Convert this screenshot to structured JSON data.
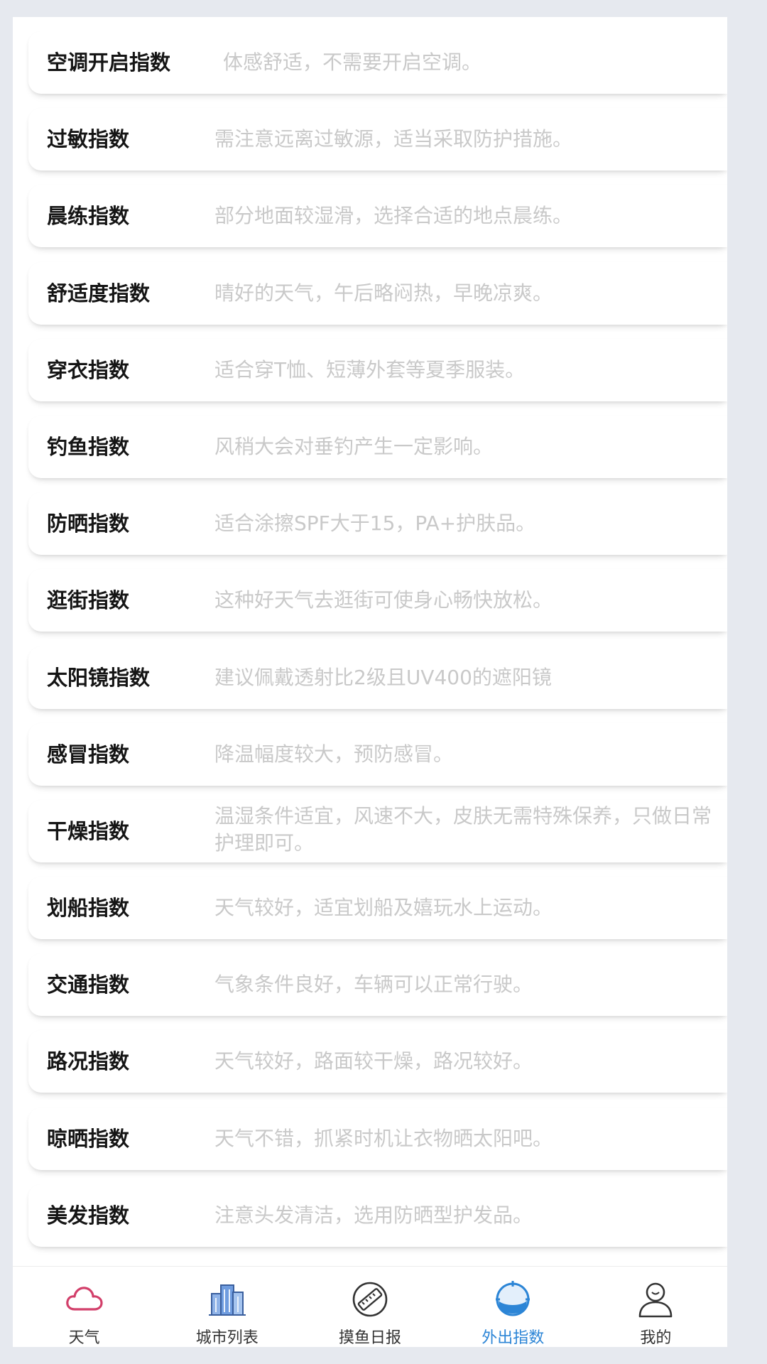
{
  "indices": [
    {
      "name": "空调开启指数",
      "desc": "体感舒适，不需要开启空调。"
    },
    {
      "name": "过敏指数",
      "desc": "需注意远离过敏源，适当采取防护措施。"
    },
    {
      "name": "晨练指数",
      "desc": "部分地面较湿滑，选择合适的地点晨练。"
    },
    {
      "name": "舒适度指数",
      "desc": "晴好的天气，午后略闷热，早晚凉爽。"
    },
    {
      "name": "穿衣指数",
      "desc": "适合穿T恤、短薄外套等夏季服装。"
    },
    {
      "name": "钓鱼指数",
      "desc": "风稍大会对垂钓产生一定影响。"
    },
    {
      "name": "防晒指数",
      "desc": "适合涂擦SPF大于15，PA+护肤品。"
    },
    {
      "name": "逛街指数",
      "desc": "这种好天气去逛街可使身心畅快放松。"
    },
    {
      "name": "太阳镜指数",
      "desc": "建议佩戴透射比2级且UV400的遮阳镜"
    },
    {
      "name": "感冒指数",
      "desc": "降温幅度较大，预防感冒。"
    },
    {
      "name": "干燥指数",
      "desc": "温湿条件适宜，风速不大，皮肤无需特殊保养，只做日常护理即可。"
    },
    {
      "name": "划船指数",
      "desc": "天气较好，适宜划船及嬉玩水上运动。"
    },
    {
      "name": "交通指数",
      "desc": "气象条件良好，车辆可以正常行驶。"
    },
    {
      "name": "路况指数",
      "desc": "天气较好，路面较干燥，路况较好。"
    },
    {
      "name": "晾晒指数",
      "desc": "天气不错，抓紧时机让衣物晒太阳吧。"
    },
    {
      "name": "美发指数",
      "desc": "注意头发清洁，选用防晒型护发品。"
    }
  ],
  "tabbar": {
    "items": [
      {
        "label": "天气",
        "icon": "cloud-icon",
        "active": false
      },
      {
        "label": "城市列表",
        "icon": "buildings-icon",
        "active": false
      },
      {
        "label": "摸鱼日报",
        "icon": "ruler-icon",
        "active": false
      },
      {
        "label": "外出指数",
        "icon": "compass-icon",
        "active": true
      },
      {
        "label": "我的",
        "icon": "user-icon",
        "active": false
      }
    ],
    "active_color": "#2c85d6"
  }
}
